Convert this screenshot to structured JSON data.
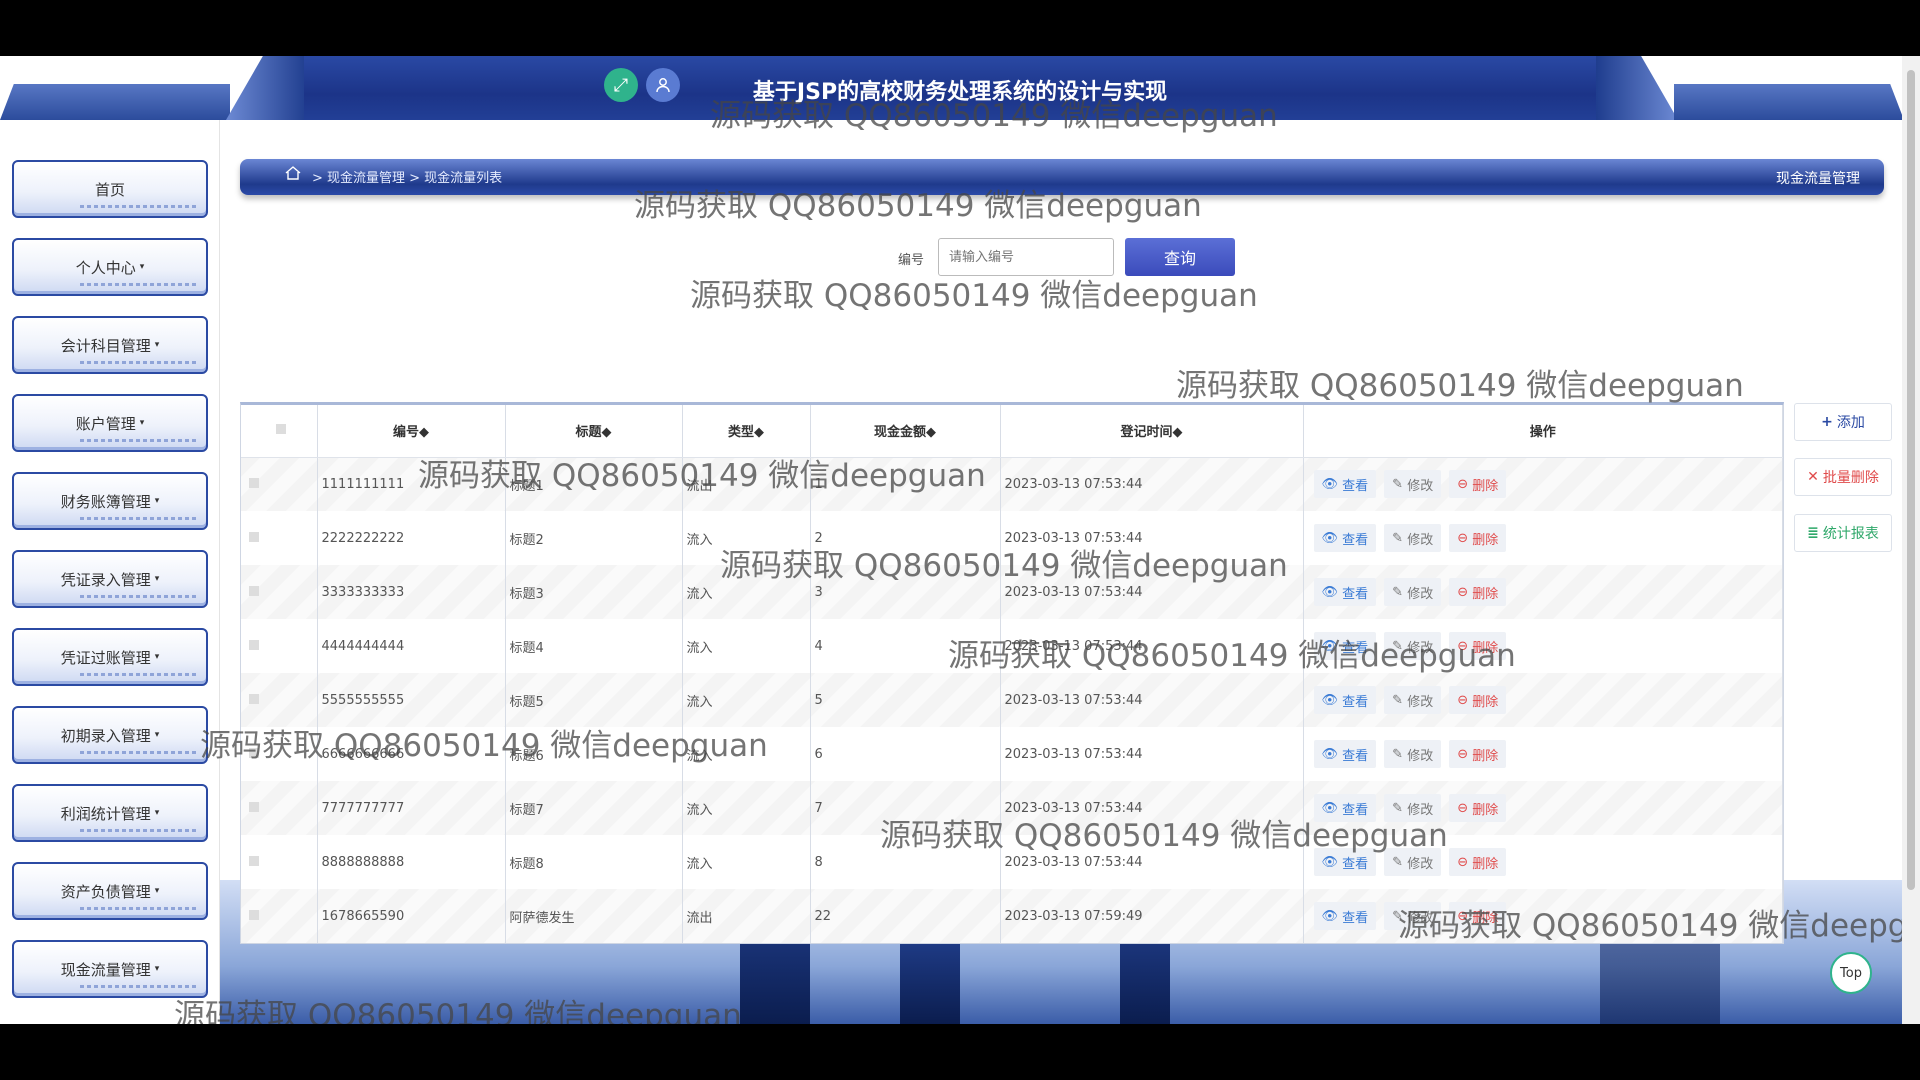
{
  "header": {
    "title": "基于JSP的高校财务处理系统的设计与实现",
    "fullscreen_icon": "expand-icon",
    "user_icon": "user-icon"
  },
  "sidebar": {
    "items": [
      {
        "label": "首页",
        "caret": ""
      },
      {
        "label": "个人中心",
        "caret": "▾"
      },
      {
        "label": "会计科目管理",
        "caret": "▾"
      },
      {
        "label": "账户管理",
        "caret": "▾"
      },
      {
        "label": "财务账簿管理",
        "caret": "▾"
      },
      {
        "label": "凭证录入管理",
        "caret": "▾"
      },
      {
        "label": "凭证过账管理",
        "caret": "▾"
      },
      {
        "label": "初期录入管理",
        "caret": "▾"
      },
      {
        "label": "利润统计管理",
        "caret": "▾"
      },
      {
        "label": "资产负债管理",
        "caret": "▾"
      },
      {
        "label": "现金流量管理",
        "caret": "▾"
      }
    ]
  },
  "breadcrumb": {
    "text": "> 现金流量管理 > 现金流量列表",
    "right_title": "现金流量管理"
  },
  "search": {
    "label": "编号",
    "placeholder": "请输入编号",
    "button": "查询"
  },
  "actions": {
    "add": "添加",
    "batch_delete": "批量删除",
    "report": "统计报表"
  },
  "table": {
    "headers": [
      "编号◆",
      "标题◆",
      "类型◆",
      "现金金额◆",
      "登记时间◆",
      "操作"
    ],
    "op_labels": {
      "view": "查看",
      "edit": "修改",
      "delete": "删除"
    },
    "rows": [
      {
        "id": "1111111111",
        "title": "标题1",
        "type": "流出",
        "amount": "1",
        "time": "2023-03-13 07:53:44"
      },
      {
        "id": "2222222222",
        "title": "标题2",
        "type": "流入",
        "amount": "2",
        "time": "2023-03-13 07:53:44"
      },
      {
        "id": "3333333333",
        "title": "标题3",
        "type": "流入",
        "amount": "3",
        "time": "2023-03-13 07:53:44"
      },
      {
        "id": "4444444444",
        "title": "标题4",
        "type": "流入",
        "amount": "4",
        "time": "2023-03-13 07:53:44"
      },
      {
        "id": "5555555555",
        "title": "标题5",
        "type": "流入",
        "amount": "5",
        "time": "2023-03-13 07:53:44"
      },
      {
        "id": "6666666666",
        "title": "标题6",
        "type": "流入",
        "amount": "6",
        "time": "2023-03-13 07:53:44"
      },
      {
        "id": "7777777777",
        "title": "标题7",
        "type": "流入",
        "amount": "7",
        "time": "2023-03-13 07:53:44"
      },
      {
        "id": "8888888888",
        "title": "标题8",
        "type": "流入",
        "amount": "8",
        "time": "2023-03-13 07:53:44"
      },
      {
        "id": "1678665590",
        "title": "阿萨德发生",
        "type": "流出",
        "amount": "22",
        "time": "2023-03-13 07:59:49"
      }
    ]
  },
  "top_button": "Top",
  "watermark": "源码获取 QQ86050149 微信deepguan"
}
